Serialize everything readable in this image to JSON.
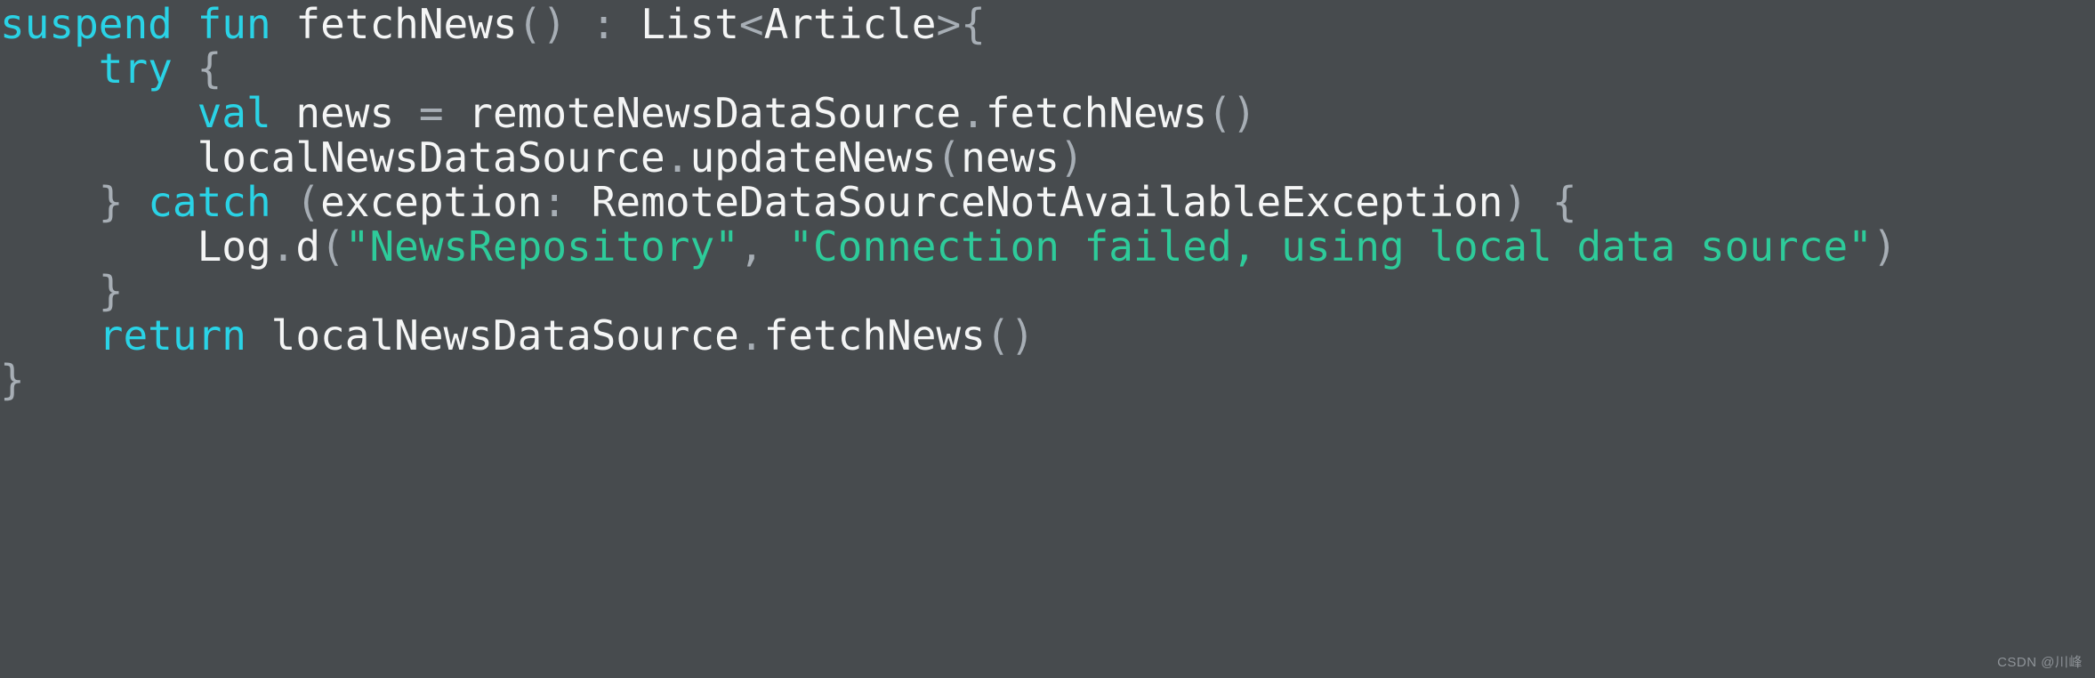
{
  "editor": {
    "background_color": "#474b4e",
    "language": "kotlin",
    "syntax_colors": {
      "keyword": "#2ad3e6",
      "identifier": "#f4f5f5",
      "punctuation": "#a7aeb5",
      "string": "#2ecb9a"
    },
    "code_text": "suspend fun fetchNews() : List<Article>{\n    try {\n        val news = remoteNewsDataSource.fetchNews()\n        localNewsDataSource.updateNews(news)\n    } catch (exception: RemoteDataSourceNotAvailableException) {\n        Log.d(\"NewsRepository\", \"Connection failed, using local data source\")\n    }\n    return localNewsDataSource.fetchNews()\n}",
    "lines": [
      {
        "number": 1,
        "tokens": [
          {
            "t": "suspend",
            "k": "kw"
          },
          {
            "t": " ",
            "k": "punc"
          },
          {
            "t": "fun",
            "k": "kw"
          },
          {
            "t": " ",
            "k": "punc"
          },
          {
            "t": "fetchNews",
            "k": "ident"
          },
          {
            "t": "()",
            "k": "punc"
          },
          {
            "t": " ",
            "k": "punc"
          },
          {
            "t": ":",
            "k": "punc"
          },
          {
            "t": " ",
            "k": "punc"
          },
          {
            "t": "List",
            "k": "ident"
          },
          {
            "t": "<",
            "k": "punc"
          },
          {
            "t": "Article",
            "k": "ident"
          },
          {
            "t": ">{",
            "k": "punc"
          }
        ]
      },
      {
        "number": 2,
        "tokens": [
          {
            "t": "    ",
            "k": "punc"
          },
          {
            "t": "try",
            "k": "kw"
          },
          {
            "t": " {",
            "k": "punc"
          }
        ]
      },
      {
        "number": 3,
        "tokens": [
          {
            "t": "        ",
            "k": "punc"
          },
          {
            "t": "val",
            "k": "kw"
          },
          {
            "t": " ",
            "k": "punc"
          },
          {
            "t": "news",
            "k": "ident"
          },
          {
            "t": " ",
            "k": "punc"
          },
          {
            "t": "=",
            "k": "punc"
          },
          {
            "t": " ",
            "k": "punc"
          },
          {
            "t": "remoteNewsDataSource",
            "k": "ident"
          },
          {
            "t": ".",
            "k": "punc"
          },
          {
            "t": "fetchNews",
            "k": "ident"
          },
          {
            "t": "()",
            "k": "punc"
          }
        ]
      },
      {
        "number": 4,
        "tokens": [
          {
            "t": "        ",
            "k": "punc"
          },
          {
            "t": "localNewsDataSource",
            "k": "ident"
          },
          {
            "t": ".",
            "k": "punc"
          },
          {
            "t": "updateNews",
            "k": "ident"
          },
          {
            "t": "(",
            "k": "punc"
          },
          {
            "t": "news",
            "k": "ident"
          },
          {
            "t": ")",
            "k": "punc"
          }
        ]
      },
      {
        "number": 5,
        "tokens": [
          {
            "t": "    ",
            "k": "punc"
          },
          {
            "t": "}",
            "k": "punc"
          },
          {
            "t": " ",
            "k": "punc"
          },
          {
            "t": "catch",
            "k": "kw"
          },
          {
            "t": " ",
            "k": "punc"
          },
          {
            "t": "(",
            "k": "punc"
          },
          {
            "t": "exception",
            "k": "ident"
          },
          {
            "t": ":",
            "k": "punc"
          },
          {
            "t": " ",
            "k": "punc"
          },
          {
            "t": "RemoteDataSourceNotAvailableException",
            "k": "ident"
          },
          {
            "t": ")",
            "k": "punc"
          },
          {
            "t": " {",
            "k": "punc"
          }
        ]
      },
      {
        "number": 6,
        "wrapped": true,
        "tokens": [
          {
            "t": "        ",
            "k": "punc"
          },
          {
            "t": "Log",
            "k": "ident"
          },
          {
            "t": ".",
            "k": "punc"
          },
          {
            "t": "d",
            "k": "ident"
          },
          {
            "t": "(",
            "k": "punc"
          },
          {
            "t": "\"NewsRepository\"",
            "k": "str"
          },
          {
            "t": ",",
            "k": "punc"
          },
          {
            "t": " ",
            "k": "punc"
          },
          {
            "t": "\"Connection failed, using local data source\"",
            "k": "str"
          },
          {
            "t": ")",
            "k": "punc"
          }
        ]
      },
      {
        "number": 7,
        "tokens": [
          {
            "t": "    ",
            "k": "punc"
          },
          {
            "t": "}",
            "k": "punc"
          }
        ]
      },
      {
        "number": 8,
        "tokens": [
          {
            "t": "    ",
            "k": "punc"
          },
          {
            "t": "return",
            "k": "kw"
          },
          {
            "t": " ",
            "k": "punc"
          },
          {
            "t": "localNewsDataSource",
            "k": "ident"
          },
          {
            "t": ".",
            "k": "punc"
          },
          {
            "t": "fetchNews",
            "k": "ident"
          },
          {
            "t": "()",
            "k": "punc"
          }
        ]
      },
      {
        "number": 9,
        "tokens": [
          {
            "t": "}",
            "k": "punc"
          }
        ]
      }
    ]
  },
  "watermark": {
    "text": "CSDN @川峰"
  }
}
